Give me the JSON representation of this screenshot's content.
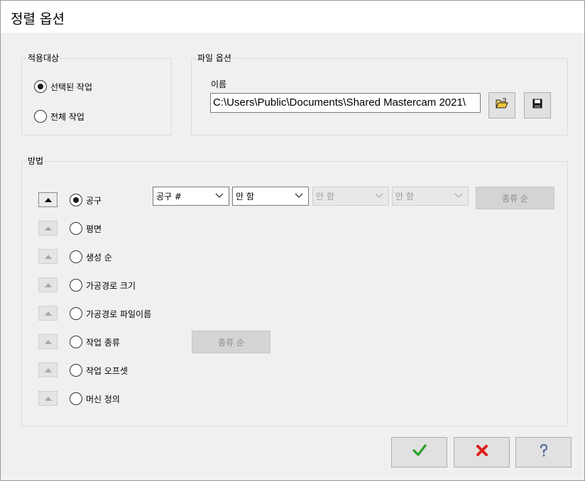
{
  "title": "정렬 옵션",
  "apply_to": {
    "legend": "적용대상",
    "options": [
      "선택된 작업",
      "전체 작업"
    ],
    "selected": 0
  },
  "file_options": {
    "legend": "파일 옵션",
    "name_label": "이름",
    "path_value": "C:\\Users\\Public\\Documents\\Shared Mastercam 2021\\",
    "open_icon": "folder-open-icon",
    "save_icon": "floppy-disk-icon"
  },
  "method": {
    "legend": "방법",
    "rows": [
      "공구",
      "평면",
      "생성 순",
      "가공경로 크기",
      "가공경로 파일이름",
      "작업 종류",
      "작업 오프셋",
      "머신 정의"
    ],
    "selected": 0,
    "dropdowns": [
      {
        "value": "공구 #",
        "enabled": true
      },
      {
        "value": "안 함",
        "enabled": true
      },
      {
        "value": "안 함",
        "enabled": false
      },
      {
        "value": "안 함",
        "enabled": false
      }
    ],
    "sort_button_1": "종류 순",
    "sort_button_2": "종류 순"
  },
  "buttons": {
    "ok_icon": "checkmark-icon",
    "cancel_icon": "red-x-icon",
    "help_icon": "question-mark-icon"
  },
  "colors": {
    "ok": "#2aa12a",
    "cancel": "#e0201a",
    "help": "#5a6aa0"
  }
}
